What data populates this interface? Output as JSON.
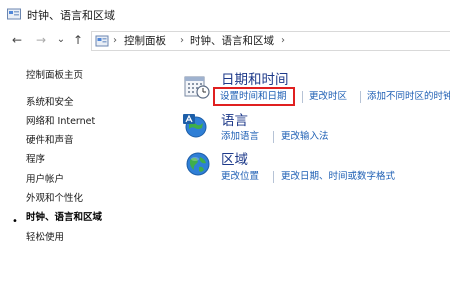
{
  "window": {
    "title": "时钟、语言和区域"
  },
  "nav": {
    "back_glyph": "←",
    "forward_glyph": "→",
    "dropdown_glyph": "⌄",
    "up_glyph": "↑",
    "separator": "›",
    "breadcrumbs": [
      "控制面板",
      "时钟、语言和区域"
    ]
  },
  "sidebar": {
    "items": [
      {
        "label": "控制面板主页"
      },
      {
        "label": "系统和安全"
      },
      {
        "label": "网络和 Internet"
      },
      {
        "label": "硬件和声音"
      },
      {
        "label": "程序"
      },
      {
        "label": "用户帐户"
      },
      {
        "label": "外观和个性化"
      },
      {
        "label": "时钟、语言和区域",
        "current": true
      },
      {
        "label": "轻松使用"
      }
    ],
    "bullet": "•"
  },
  "categories": [
    {
      "title": "日期和时间",
      "icon": "calendar-clock-icon",
      "tasks": [
        "设置时间和日期",
        "更改时区",
        "添加不同时区的时钟"
      ]
    },
    {
      "title": "语言",
      "icon": "language-globe-icon",
      "tasks": [
        "添加语言",
        "更改输入法"
      ]
    },
    {
      "title": "区域",
      "icon": "region-globe-icon",
      "tasks": [
        "更改位置",
        "更改日期、时间或数字格式"
      ]
    }
  ],
  "colors": {
    "link": "#1e5fb4",
    "category_title": "#1e3a8a",
    "highlight_border": "#e02020"
  }
}
